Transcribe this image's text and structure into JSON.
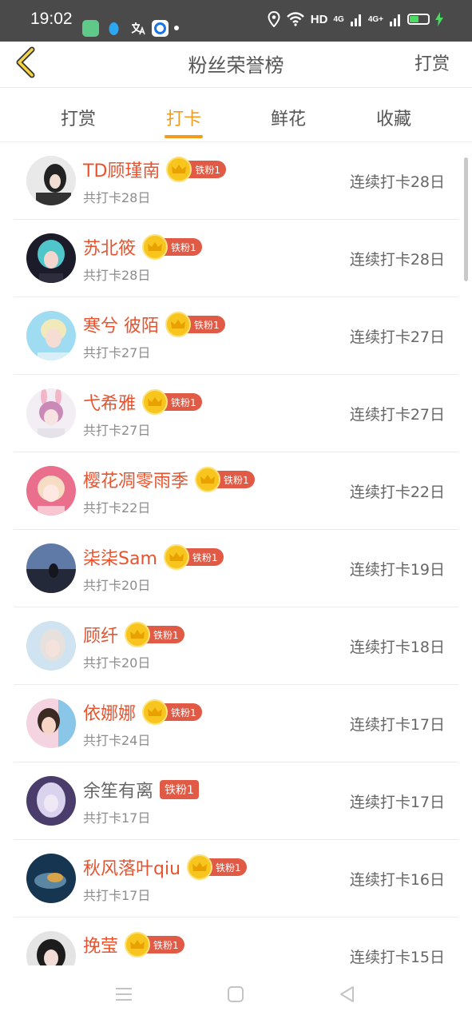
{
  "status_bar": {
    "time": "19:02",
    "network_label": "HD",
    "signal_1": "4G",
    "signal_2": "4G+"
  },
  "header": {
    "title": "粉丝荣誉榜",
    "right_action": "打赏",
    "back_icon": "chevron-left-icon"
  },
  "tabs": [
    {
      "label": "打赏",
      "active": false
    },
    {
      "label": "打卡",
      "active": true
    },
    {
      "label": "鲜花",
      "active": false
    },
    {
      "label": "收藏",
      "active": false
    }
  ],
  "colors": {
    "accent": "#f29c1f",
    "name": "#e8532e",
    "badge": "#e05a45",
    "crown": "#f7c51e"
  },
  "fans": [
    {
      "name": "TD顾瑾南",
      "badge": "铁粉1",
      "crown": true,
      "total": "共打卡28日",
      "streak": "连续打卡28日"
    },
    {
      "name": "苏北筱",
      "badge": "铁粉1",
      "crown": true,
      "total": "共打卡28日",
      "streak": "连续打卡28日"
    },
    {
      "name": "寒兮 彼陌",
      "badge": "铁粉1",
      "crown": true,
      "total": "共打卡27日",
      "streak": "连续打卡27日"
    },
    {
      "name": "弋希雅",
      "badge": "铁粉1",
      "crown": true,
      "total": "共打卡27日",
      "streak": "连续打卡27日"
    },
    {
      "name": "樱花凋零雨季",
      "badge": "铁粉1",
      "crown": true,
      "total": "共打卡22日",
      "streak": "连续打卡22日"
    },
    {
      "name": "柒柒Sam",
      "badge": "铁粉1",
      "crown": true,
      "total": "共打卡20日",
      "streak": "连续打卡19日"
    },
    {
      "name": "顾纤",
      "badge": "铁粉1",
      "crown": true,
      "total": "共打卡20日",
      "streak": "连续打卡18日"
    },
    {
      "name": "依娜娜",
      "badge": "铁粉1",
      "crown": true,
      "total": "共打卡24日",
      "streak": "连续打卡17日"
    },
    {
      "name": "余笙有离",
      "badge": "铁粉1",
      "crown": false,
      "total": "共打卡17日",
      "streak": "连续打卡17日"
    },
    {
      "name": "秋风落叶qiu",
      "badge": "铁粉1",
      "crown": true,
      "total": "共打卡17日",
      "streak": "连续打卡16日"
    },
    {
      "name": "挽莹",
      "badge": "铁粉1",
      "crown": true,
      "total": "",
      "streak": "连续打卡15日"
    }
  ],
  "nav_bar": {
    "menu_icon": "menu-icon",
    "home_icon": "home-square-icon",
    "back_icon": "back-triangle-icon"
  }
}
